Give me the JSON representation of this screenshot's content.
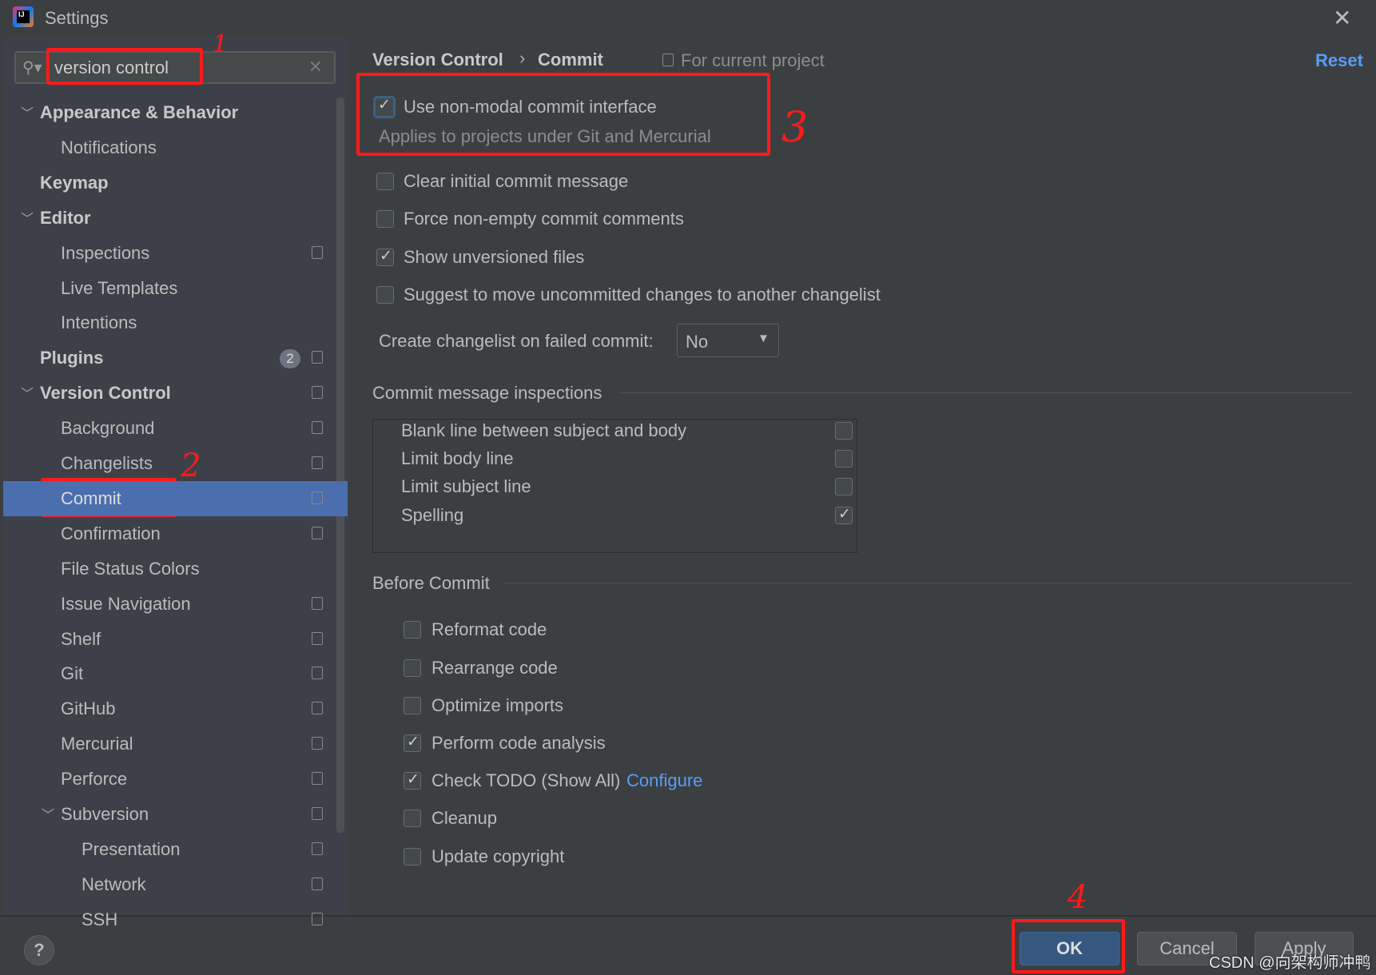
{
  "window": {
    "title": "Settings",
    "close": "✕"
  },
  "search": {
    "value": "version control",
    "clear": "✕"
  },
  "sidebar": {
    "items": [
      {
        "label": "Appearance & Behavior",
        "level": 0,
        "bold": true,
        "expanded": true
      },
      {
        "label": "Notifications",
        "level": 1
      },
      {
        "label": "Keymap",
        "level": 0,
        "bold": true
      },
      {
        "label": "Editor",
        "level": 0,
        "bold": true,
        "expanded": true
      },
      {
        "label": "Inspections",
        "level": 1,
        "project": true
      },
      {
        "label": "Live Templates",
        "level": 1
      },
      {
        "label": "Intentions",
        "level": 1
      },
      {
        "label": "Plugins",
        "level": 0,
        "bold": true,
        "badge": "2",
        "project": true
      },
      {
        "label": "Version Control",
        "level": 0,
        "bold": true,
        "expanded": true,
        "project": true
      },
      {
        "label": "Background",
        "level": 1,
        "project": true
      },
      {
        "label": "Changelists",
        "level": 1,
        "project": true
      },
      {
        "label": "Commit",
        "level": 1,
        "project": true,
        "selected": true
      },
      {
        "label": "Confirmation",
        "level": 1,
        "project": true
      },
      {
        "label": "File Status Colors",
        "level": 1
      },
      {
        "label": "Issue Navigation",
        "level": 1,
        "project": true
      },
      {
        "label": "Shelf",
        "level": 1,
        "project": true
      },
      {
        "label": "Git",
        "level": 1,
        "project": true
      },
      {
        "label": "GitHub",
        "level": 1,
        "project": true
      },
      {
        "label": "Mercurial",
        "level": 1,
        "project": true
      },
      {
        "label": "Perforce",
        "level": 1,
        "project": true
      },
      {
        "label": "Subversion",
        "level": 1,
        "project": true,
        "expanded": true
      },
      {
        "label": "Presentation",
        "level": 2,
        "project": true
      },
      {
        "label": "Network",
        "level": 2,
        "project": true
      },
      {
        "label": "SSH",
        "level": 2,
        "project": true
      }
    ]
  },
  "header": {
    "breadcrumb": [
      "Version Control",
      "Commit"
    ],
    "separator": "›",
    "scope": "For current project",
    "reset": "Reset"
  },
  "options": [
    {
      "label": "Use non-modal commit interface",
      "checked": true,
      "hint": "Applies to projects under Git and Mercurial"
    },
    {
      "label": "Clear initial commit message",
      "checked": false
    },
    {
      "label": "Force non-empty commit comments",
      "checked": false
    },
    {
      "label": "Show unversioned files",
      "checked": true
    },
    {
      "label": "Suggest to move uncommitted changes to another changelist",
      "checked": false
    }
  ],
  "changelist": {
    "label": "Create changelist on failed commit:",
    "value": "No"
  },
  "inspections": {
    "title": "Commit message inspections",
    "items": [
      {
        "label": "Blank line between subject and body",
        "checked": false
      },
      {
        "label": "Limit body line",
        "checked": false
      },
      {
        "label": "Limit subject line",
        "checked": false
      },
      {
        "label": "Spelling",
        "checked": true
      }
    ]
  },
  "before_commit": {
    "title": "Before Commit",
    "items": [
      {
        "label": "Reformat code",
        "checked": false
      },
      {
        "label": "Rearrange code",
        "checked": false
      },
      {
        "label": "Optimize imports",
        "checked": false
      },
      {
        "label": "Perform code analysis",
        "checked": true
      },
      {
        "label": "Check TODO (Show All)",
        "checked": true,
        "link": "Configure"
      },
      {
        "label": "Cleanup",
        "checked": false
      },
      {
        "label": "Update copyright",
        "checked": false
      }
    ]
  },
  "footer": {
    "help": "?",
    "ok": "OK",
    "cancel": "Cancel",
    "apply": "Apply"
  },
  "annotations": [
    "1",
    "2",
    "3",
    "4"
  ],
  "watermark": "CSDN @向架构师冲鸭",
  "colors": {
    "selection": "#4b6eaf",
    "link": "#589df6",
    "annotation": "#ff1a1a"
  }
}
